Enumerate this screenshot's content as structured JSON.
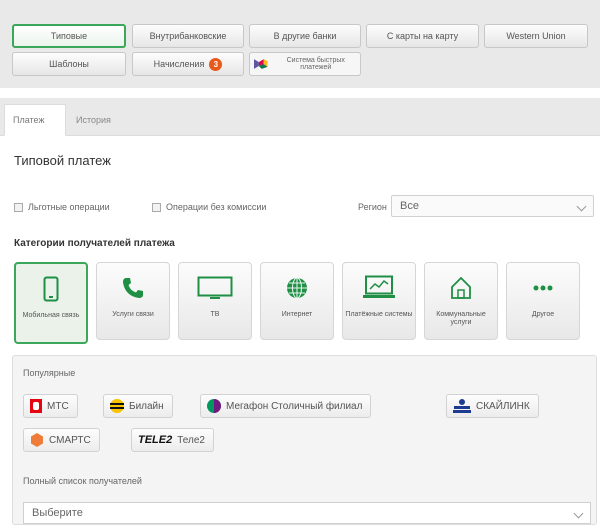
{
  "transfer_types": [
    {
      "label": "Типовые",
      "active": true
    },
    {
      "label": "Внутрибанковские"
    },
    {
      "label": "В другие банки"
    },
    {
      "label": "С карты на карту"
    },
    {
      "label": "Western Union"
    }
  ],
  "second_row": {
    "templates": "Шаблоны",
    "charges": "Начисления",
    "charges_badge": "3",
    "sbp": "Система быстрых платежей"
  },
  "tabs": [
    {
      "label": "Платеж",
      "active": true
    },
    {
      "label": "История"
    }
  ],
  "page_title": "Типовой платеж",
  "filters": {
    "preferential": "Льготные операции",
    "no_commission": "Операции без комиссии",
    "region_label": "Регион",
    "region_value": "Все"
  },
  "categories_title": "Категории получателей платежа",
  "categories": [
    {
      "label": "Мобильная связь",
      "icon": "mobile-phone-icon",
      "active": true
    },
    {
      "label": "Услуги связи",
      "icon": "telephone-handset-icon"
    },
    {
      "label": "ТВ",
      "icon": "tv-icon"
    },
    {
      "label": "Интернет",
      "icon": "globe-icon"
    },
    {
      "label": "Платёжные системы",
      "icon": "payment-screen-icon"
    },
    {
      "label": "Коммунальные услуги",
      "icon": "house-icon"
    },
    {
      "label": "Другое",
      "icon": "ellipsis-icon"
    }
  ],
  "popular_label": "Популярные",
  "operators": [
    {
      "label": "МТС",
      "icon": "mts-logo-icon"
    },
    {
      "label": "Билайн",
      "icon": "beeline-logo-icon"
    },
    {
      "label": "Мегафон Столичный филиал",
      "icon": "megafon-logo-icon"
    },
    {
      "label": "СКАЙЛИНК",
      "icon": "skylink-logo-icon"
    },
    {
      "label": "СМАРТС",
      "icon": "smarts-logo-icon"
    },
    {
      "label": "Теле2",
      "icon": "tele2-logo-icon",
      "logo_text": "TELE2"
    }
  ],
  "full_list_label": "Полный список получателей",
  "full_list_value": "Выберите",
  "colors": {
    "accent": "#3ca65a",
    "badge": "#e8591a",
    "icon_green": "#1e8f45"
  }
}
